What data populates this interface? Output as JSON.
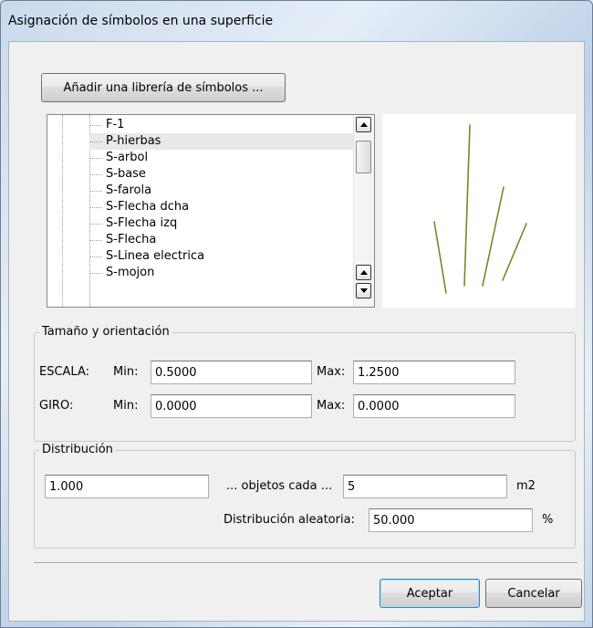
{
  "window": {
    "title": "Asignación de símbolos en una superficie"
  },
  "library_button": "Añadir una librería de símbolos ...",
  "symbols": {
    "items": [
      "F-1",
      "P-hierbas",
      "S-arbol",
      "S-base",
      "S-farola",
      "S-Flecha dcha",
      "S-Flecha izq",
      "S-Flecha",
      "S-Linea electrica",
      "S-mojon"
    ],
    "selected": "P-hierbas"
  },
  "preview": {
    "icon": "grass-symbol-preview",
    "stroke_color": "#6b8e23"
  },
  "size_group": {
    "label": "Tamaño y orientación",
    "scale_label": "ESCALA:",
    "rotation_label": "GIRO:",
    "min_label": "Min:",
    "max_label": "Max:",
    "scale_min": "0.5000",
    "scale_max": "1.2500",
    "rotation_min": "0.0000",
    "rotation_max": "0.0000"
  },
  "distribution_group": {
    "label": "Distribución",
    "count": "1.000",
    "per_label": "... objetos cada ...",
    "area": "5",
    "area_unit": "m2",
    "random_label": "Distribución aleatoria:",
    "random_value": "50.000",
    "random_unit": "%"
  },
  "buttons": {
    "ok": "Aceptar",
    "cancel": "Cancelar"
  }
}
